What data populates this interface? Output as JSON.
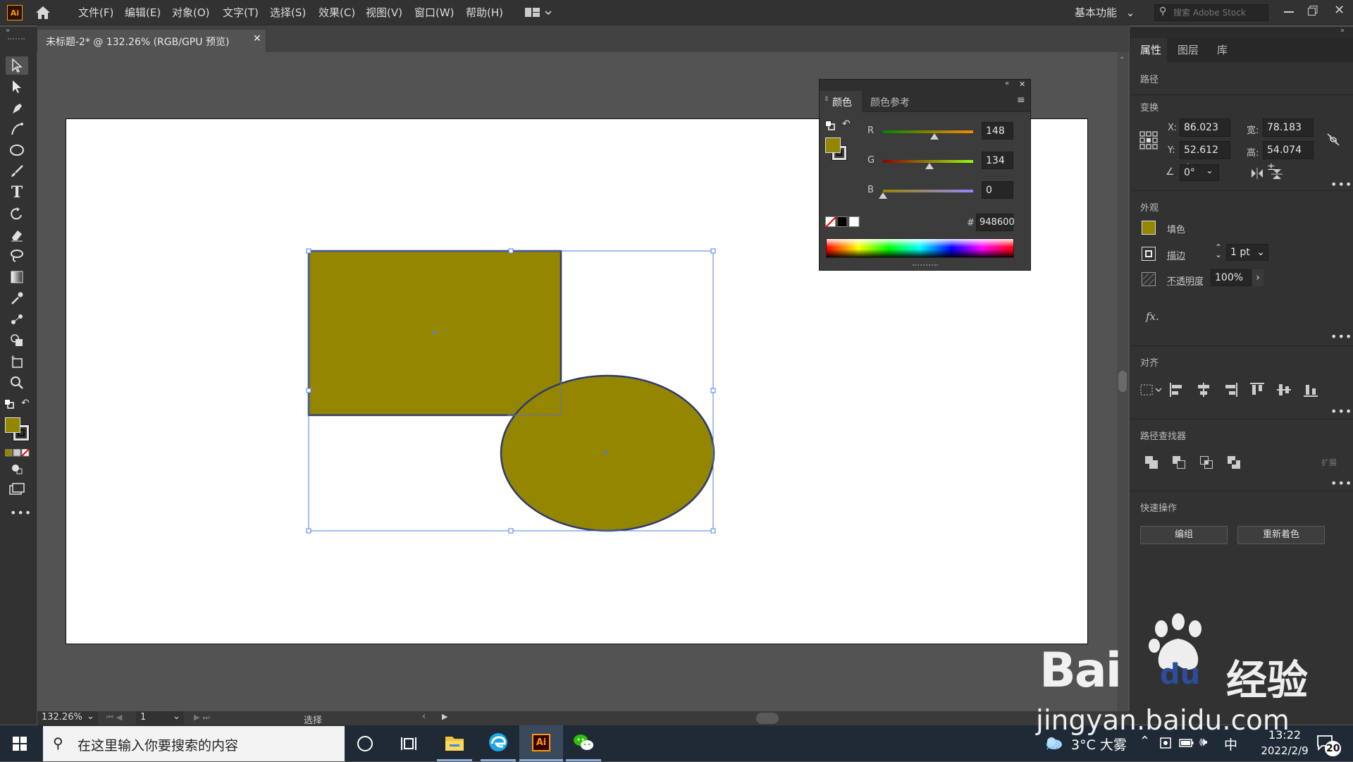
{
  "app": {
    "logo": "Ai"
  },
  "menu": {
    "items": [
      "文件(F)",
      "编辑(E)",
      "对象(O)",
      "文字(T)",
      "选择(S)",
      "效果(C)",
      "视图(V)",
      "窗口(W)",
      "帮助(H)"
    ],
    "workspace": "基本功能",
    "search_placeholder": "搜索 Adobe Stock"
  },
  "document": {
    "tab_title": "未标题-2* @ 132.26% (RGB/GPU 预览)",
    "fill_color": "#948600"
  },
  "color_panel": {
    "tabs": [
      "颜色",
      "颜色参考"
    ],
    "r_label": "R",
    "r_value": "148",
    "g_label": "G",
    "g_value": "134",
    "b_label": "B",
    "b_value": "0",
    "hash": "#",
    "hex_value": "948600"
  },
  "properties": {
    "tabs": [
      "属性",
      "图层",
      "库"
    ],
    "object_type": "路径",
    "transform_title": "变换",
    "x_label": "X:",
    "x_value": "86.023 ±",
    "y_label": "Y:",
    "y_value": "52.612 ±",
    "w_label": "宽:",
    "w_value": "78.183 ±",
    "h_label": "高:",
    "h_value": "54.074 ±",
    "angle_value": "0°",
    "appearance_title": "外观",
    "fill_label": "填色",
    "stroke_label": "描边",
    "stroke_value": "1 pt",
    "opacity_label": "不透明度",
    "opacity_value": "100%",
    "fx_label": "fx.",
    "align_title": "对齐",
    "pathfinder_title": "路径查找器",
    "expand_label": "扩展",
    "quick_title": "快速操作",
    "group_button": "编组",
    "recolor_button": "重新着色"
  },
  "status": {
    "zoom": "132.26%",
    "page": "1",
    "tool": "选择"
  },
  "taskbar": {
    "search_placeholder": "在这里输入你要搜索的内容",
    "weather": "3°C 大雾",
    "ime": "中",
    "time": "13:22",
    "date": "2022/2/9",
    "notifications": "20",
    "ai_label": "Ai"
  },
  "watermark": {
    "brand": "Bai",
    "brand2": "du",
    "suffix": "经验",
    "url": "jingyan.baidu.com"
  }
}
